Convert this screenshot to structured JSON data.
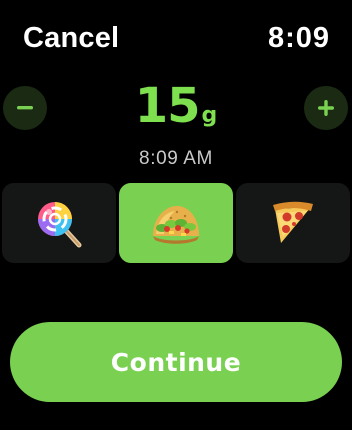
{
  "topbar": {
    "cancel_label": "Cancel",
    "clock": "8:09"
  },
  "carbs": {
    "value": "15",
    "unit": "g",
    "decrement_icon": "minus-icon",
    "increment_icon": "plus-icon"
  },
  "entry_time": "8:09 AM",
  "food_types": [
    {
      "icon": "lollipop-icon",
      "selected": false
    },
    {
      "icon": "taco-icon",
      "selected": true
    },
    {
      "icon": "pizza-icon",
      "selected": false
    }
  ],
  "continue_label": "Continue",
  "colors": {
    "accent": "#7ad151",
    "value_text": "#7ee04e",
    "stepper_bg": "#1b2a12",
    "tile_bg": "#151716",
    "background": "#000000"
  }
}
